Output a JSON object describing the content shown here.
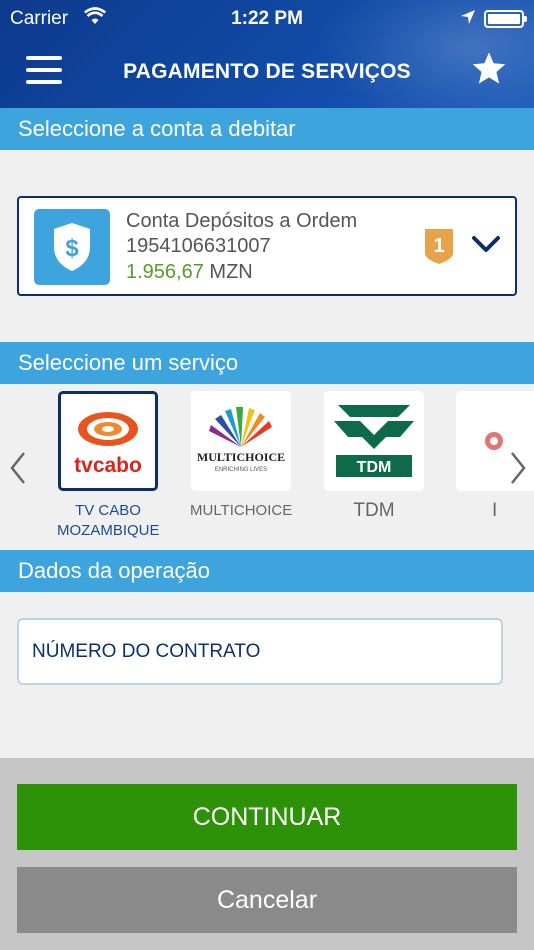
{
  "status_bar": {
    "carrier": "Carrier",
    "time": "1:22 PM"
  },
  "header": {
    "title": "PAGAMENTO DE SERVIÇOS",
    "menu_icon": "hamburger-icon",
    "favorite_icon": "star-icon"
  },
  "sections": {
    "account": "Seleccione a conta a debitar",
    "service": "Seleccione um serviço",
    "operation": "Dados da operação"
  },
  "account": {
    "name": "Conta Depósitos a Ordem",
    "number": "1954106631007",
    "balance_amount": "1.956,67",
    "currency": "MZN",
    "badge": "1",
    "icon": "shield-dollar-icon"
  },
  "services": [
    {
      "label": "TV CABO MOZAMBIQUE",
      "logo_text": "tvcabo",
      "selected": true
    },
    {
      "label": "MULTICHOICE",
      "logo_text": "MULTICHOICE",
      "logo_subtext": "ENRICHING LIVES",
      "selected": false
    },
    {
      "label": "TDM",
      "logo_text": "TDM",
      "selected": false
    },
    {
      "label": "I",
      "selected": false
    }
  ],
  "form": {
    "contract_placeholder": "NÚMERO DO CONTRATO"
  },
  "buttons": {
    "continue": "CONTINUAR",
    "cancel": "Cancelar"
  },
  "colors": {
    "header": "#114aa6",
    "section_bar": "#3ea4dd",
    "continue": "#2e9208",
    "cancel": "#8a8a8a",
    "balance": "#5a9a2c",
    "badge": "#e8a24a"
  }
}
